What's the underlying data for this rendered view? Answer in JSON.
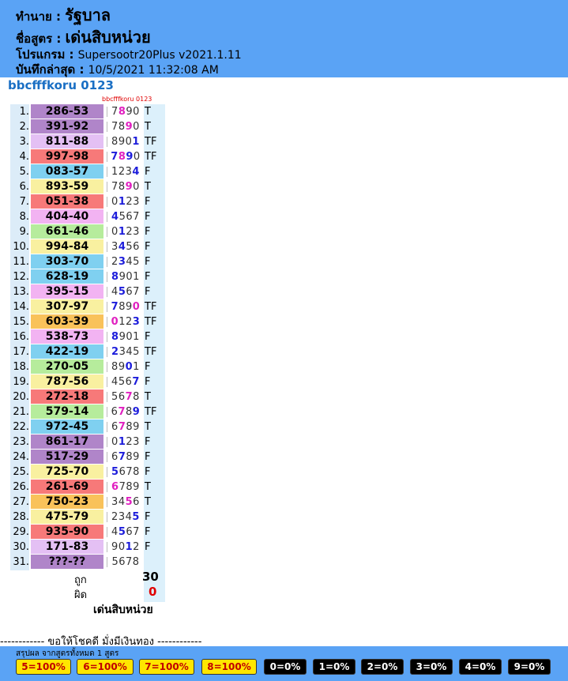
{
  "header": {
    "by_label": "ทำนาย :",
    "by_value": "รัฐบาล",
    "formula_label": "ชื่อสูตร :",
    "formula_value": "เด่นสิบหน่วย",
    "program_label": "โปรแกรม :",
    "program_value": "Supersootr20Plus v2021.1.11",
    "saved_label": "บันทึกล่าสุด :",
    "saved_value": "10/5/2021 11:32:08 AM"
  },
  "formula_title": "bbcfffkoru 0123",
  "small_label": "bbcfffkoru 0123",
  "rows": [
    {
      "num": "1.",
      "pair": "286-53",
      "color": "purple",
      "digits": "7890",
      "hi": [
        1
      ],
      "hicolor": "pink",
      "result": "T"
    },
    {
      "num": "2.",
      "pair": "391-92",
      "color": "purple",
      "digits": "7890",
      "hi": [
        2
      ],
      "hicolor": "pink",
      "result": "T"
    },
    {
      "num": "3.",
      "pair": "811-88",
      "color": "lavender",
      "digits": "8901",
      "hi": [
        3
      ],
      "hicolor": "blue",
      "result": "TF"
    },
    {
      "num": "4.",
      "pair": "997-98",
      "color": "red",
      "digits": "7890",
      "hi": [
        0,
        1,
        2
      ],
      "hicolor": "mixed",
      "result": "TF"
    },
    {
      "num": "5.",
      "pair": "083-57",
      "color": "blue",
      "digits": "1234",
      "hi": [
        3
      ],
      "hicolor": "blue",
      "result": "F"
    },
    {
      "num": "6.",
      "pair": "893-59",
      "color": "yellow",
      "digits": "7890",
      "hi": [
        2
      ],
      "hicolor": "pink",
      "result": "T"
    },
    {
      "num": "7.",
      "pair": "051-38",
      "color": "red",
      "digits": "0123",
      "hi": [
        1
      ],
      "hicolor": "blue",
      "result": "F"
    },
    {
      "num": "8.",
      "pair": "404-40",
      "color": "pink",
      "digits": "4567",
      "hi": [
        0
      ],
      "hicolor": "blue",
      "result": "F"
    },
    {
      "num": "9.",
      "pair": "661-46",
      "color": "green",
      "digits": "0123",
      "hi": [
        1
      ],
      "hicolor": "blue",
      "result": "F"
    },
    {
      "num": "10.",
      "pair": "994-84",
      "color": "yellow",
      "digits": "3456",
      "hi": [
        1
      ],
      "hicolor": "blue",
      "result": "F"
    },
    {
      "num": "11.",
      "pair": "303-70",
      "color": "blue",
      "digits": "2345",
      "hi": [
        1
      ],
      "hicolor": "blue",
      "result": "F"
    },
    {
      "num": "12.",
      "pair": "628-19",
      "color": "blue",
      "digits": "8901",
      "hi": [
        0
      ],
      "hicolor": "blue",
      "result": "F"
    },
    {
      "num": "13.",
      "pair": "395-15",
      "color": "pink",
      "digits": "4567",
      "hi": [
        1
      ],
      "hicolor": "blue",
      "result": "F"
    },
    {
      "num": "14.",
      "pair": "307-97",
      "color": "yellow",
      "digits": "7890",
      "hi": [
        0,
        3
      ],
      "hicolor": "mixed2",
      "result": "TF"
    },
    {
      "num": "15.",
      "pair": "603-39",
      "color": "orange",
      "digits": "0123",
      "hi": [
        0,
        3
      ],
      "hicolor": "mixed3",
      "result": "TF"
    },
    {
      "num": "16.",
      "pair": "538-73",
      "color": "pink",
      "digits": "8901",
      "hi": [
        0
      ],
      "hicolor": "blue",
      "result": "F"
    },
    {
      "num": "17.",
      "pair": "422-19",
      "color": "blue",
      "digits": "2345",
      "hi": [
        0
      ],
      "hicolor": "blue",
      "result": "TF"
    },
    {
      "num": "18.",
      "pair": "270-05",
      "color": "green",
      "digits": "8901",
      "hi": [
        2
      ],
      "hicolor": "blue",
      "result": "F"
    },
    {
      "num": "19.",
      "pair": "787-56",
      "color": "yellow",
      "digits": "4567",
      "hi": [
        3
      ],
      "hicolor": "blue",
      "result": "F"
    },
    {
      "num": "20.",
      "pair": "272-18",
      "color": "red",
      "digits": "5678",
      "hi": [
        2
      ],
      "hicolor": "pink",
      "result": "T"
    },
    {
      "num": "21.",
      "pair": "579-14",
      "color": "green",
      "digits": "6789",
      "hi": [
        1,
        3
      ],
      "hicolor": "mixed4",
      "result": "TF"
    },
    {
      "num": "22.",
      "pair": "972-45",
      "color": "blue",
      "digits": "6789",
      "hi": [
        1
      ],
      "hicolor": "pink",
      "result": "T"
    },
    {
      "num": "23.",
      "pair": "861-17",
      "color": "purple",
      "digits": "0123",
      "hi": [
        1
      ],
      "hicolor": "blue",
      "result": "F"
    },
    {
      "num": "24.",
      "pair": "517-29",
      "color": "purple",
      "digits": "6789",
      "hi": [
        1
      ],
      "hicolor": "blue",
      "result": "F"
    },
    {
      "num": "25.",
      "pair": "725-70",
      "color": "yellow",
      "digits": "5678",
      "hi": [
        0
      ],
      "hicolor": "blue",
      "result": "F"
    },
    {
      "num": "26.",
      "pair": "261-69",
      "color": "red",
      "digits": "6789",
      "hi": [
        0
      ],
      "hicolor": "pink",
      "result": "T"
    },
    {
      "num": "27.",
      "pair": "750-23",
      "color": "orange",
      "digits": "3456",
      "hi": [
        2
      ],
      "hicolor": "pink",
      "result": "T"
    },
    {
      "num": "28.",
      "pair": "475-79",
      "color": "yellow",
      "digits": "2345",
      "hi": [
        3
      ],
      "hicolor": "blue",
      "result": "F"
    },
    {
      "num": "29.",
      "pair": "935-90",
      "color": "red",
      "digits": "4567",
      "hi": [
        1
      ],
      "hicolor": "blue",
      "result": "F"
    },
    {
      "num": "30.",
      "pair": "171-83",
      "color": "lavender",
      "digits": "9012",
      "hi": [
        2
      ],
      "hicolor": "blue",
      "result": "F"
    },
    {
      "num": "31.",
      "pair": "???-??",
      "color": "purple",
      "digits": "5678",
      "hi": [],
      "hicolor": "none",
      "result": ""
    }
  ],
  "summary": {
    "correct_label": "ถูก",
    "correct_value": "30",
    "wrong_label": "ผิด",
    "wrong_value": "0",
    "formula_name": "เด่นสิบหน่วย"
  },
  "luck_line": "------------ ขอให้โชคดี มั่งมีเงินทอง ------------",
  "footer": {
    "caption": "สรุปผล จากสูตรทั้งหมด 1 สูตร",
    "chips": [
      {
        "label": "5=100%",
        "style": "yellow"
      },
      {
        "label": "6=100%",
        "style": "yellow"
      },
      {
        "label": "7=100%",
        "style": "yellow"
      },
      {
        "label": "8=100%",
        "style": "yellow"
      },
      {
        "label": "0=0%",
        "style": "black"
      },
      {
        "label": "1=0%",
        "style": "black"
      },
      {
        "label": "2=0%",
        "style": "black"
      },
      {
        "label": "3=0%",
        "style": "black"
      },
      {
        "label": "4=0%",
        "style": "black"
      },
      {
        "label": "9=0%",
        "style": "black"
      }
    ]
  },
  "colors": {
    "header_bg": "#5aa3f5",
    "title_blue": "#1a6fc4",
    "digit_blue": "#1d1ddb",
    "digit_pink": "#e020c0",
    "wrong_red": "#e00000",
    "chip_yellow": "#ffe600"
  }
}
